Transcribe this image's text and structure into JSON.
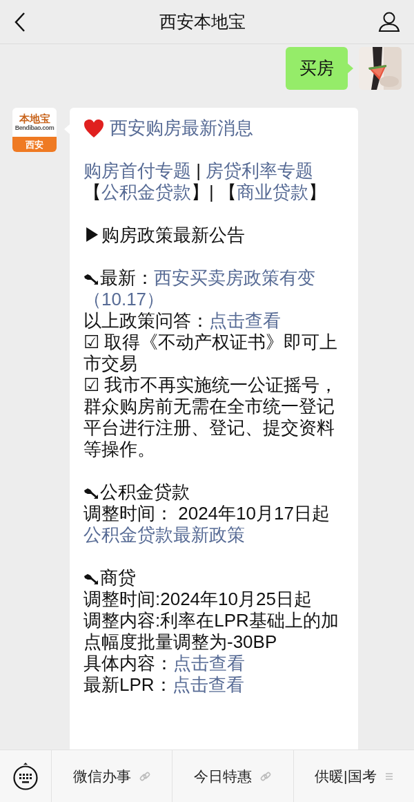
{
  "header": {
    "title": "西安本地宝"
  },
  "messages": [
    {
      "kind": "sent",
      "text": "买房"
    },
    {
      "kind": "received",
      "logo": {
        "brand": "本地宝",
        "domain": "Bendibao.com",
        "city": "西安"
      },
      "title": "西安购房最新消息",
      "paragraphs": [
        [
          {
            "kind": "text",
            "parts": [
              {
                "text": "购房首付专题",
                "link": true
              },
              {
                "text": " | ",
                "link": false
              },
              {
                "text": "房贷利率专题",
                "link": true
              }
            ]
          },
          {
            "kind": "text",
            "parts": [
              {
                "text": "【",
                "link": false
              },
              {
                "text": "公积金贷款",
                "link": true
              },
              {
                "text": "】| 【",
                "link": false
              },
              {
                "text": "商业贷款",
                "link": true
              },
              {
                "text": "】",
                "link": false
              }
            ]
          }
        ],
        [
          {
            "kind": "text",
            "parts": [
              {
                "text": "▶购房政策最新公告",
                "link": false
              }
            ]
          }
        ],
        [
          {
            "kind": "bullet",
            "parts": [
              {
                "text": "最新：",
                "link": false
              },
              {
                "text": "西安买卖房政策有变",
                "link": true
              }
            ]
          },
          {
            "kind": "text",
            "parts": [
              {
                "text": "（10.17）",
                "link": true
              }
            ]
          },
          {
            "kind": "text",
            "parts": [
              {
                "text": "以上政策问答：",
                "link": false
              },
              {
                "text": "点击查看",
                "link": true
              }
            ]
          },
          {
            "kind": "text",
            "parts": [
              {
                "text": "☑ 取得《不动产权证书》即可上市交易",
                "link": false
              }
            ]
          },
          {
            "kind": "text",
            "parts": [
              {
                "text": "☑ 我市不再实施统一公证摇号，群众购房前无需在全市统一登记平台进行注册、登记、提交资料等操作。",
                "link": false
              }
            ]
          }
        ],
        [
          {
            "kind": "bullet",
            "parts": [
              {
                "text": "公积金贷款",
                "link": false
              }
            ]
          },
          {
            "kind": "text",
            "parts": [
              {
                "text": "调整时间： 2024年10月17日起",
                "link": false
              }
            ]
          },
          {
            "kind": "text",
            "parts": [
              {
                "text": "公积金贷款最新政策",
                "link": true
              }
            ]
          }
        ],
        [
          {
            "kind": "bullet",
            "parts": [
              {
                "text": "商贷",
                "link": false
              }
            ]
          },
          {
            "kind": "text",
            "parts": [
              {
                "text": "调整时间:2024年10月25日起",
                "link": false
              }
            ]
          },
          {
            "kind": "text",
            "parts": [
              {
                "text": "调整内容:利率在LPR基础上的加点幅度批量调整为-30BP",
                "link": false
              }
            ]
          },
          {
            "kind": "text",
            "parts": [
              {
                "text": "具体内容：",
                "link": false
              },
              {
                "text": "点击查看",
                "link": true
              }
            ]
          },
          {
            "kind": "text",
            "parts": [
              {
                "text": "最新LPR：",
                "link": false
              },
              {
                "text": "点击查看",
                "link": true
              }
            ]
          }
        ]
      ]
    }
  ],
  "menu": [
    {
      "label": "微信办事",
      "kind": "link"
    },
    {
      "label": "今日特惠",
      "kind": "link"
    },
    {
      "label": "供暖|国考",
      "kind": "submenu"
    }
  ]
}
